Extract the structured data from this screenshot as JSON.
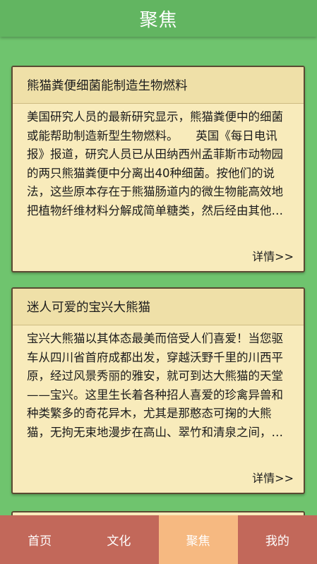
{
  "header": {
    "title": "聚焦"
  },
  "articles": [
    {
      "title": "熊猫粪便细菌能制造生物燃料",
      "excerpt": "美国研究人员的最新研究显示，熊猫粪便中的细菌或能帮助制造新型生物燃料。　　英国《每日电讯报》报道，研究人员已从田纳西州孟菲斯市动物园的两只熊猫粪便中分离出40种细菌。按他们的说法，这些原本存在于熊猫肠道内的微生物能高效地把植物纤维材料分解成简单糖类，然后经由其他细菌转化为燃料。",
      "more": "详情>>"
    },
    {
      "title": "迷人可爱的宝兴大熊猫",
      "excerpt": "宝兴大熊猫以其体态最美而倍受人们喜爱！当您驱车从四川省首府成都出发，穿越沃野千里的川西平原，经过风景秀丽的雅安，就可到达大熊猫的天堂——宝兴。这里生长着各种招人喜爱的珍禽异兽和种类繁多的奇花异木，尤其是那憨态可掬的大熊猫，无拘无束地漫步在高山、翠竹和清泉之间，时而嬉戏玩耍。",
      "more": "详情>>"
    }
  ],
  "tabs": [
    {
      "label": "首页"
    },
    {
      "label": "文化"
    },
    {
      "label": "聚焦"
    },
    {
      "label": "我的"
    }
  ],
  "active_tab": "聚焦",
  "colors": {
    "background": "#6fc46e",
    "header": "#62b561",
    "card": "#f8ebbb",
    "tab": "#c2685a",
    "tab_active": "#f6b981"
  }
}
